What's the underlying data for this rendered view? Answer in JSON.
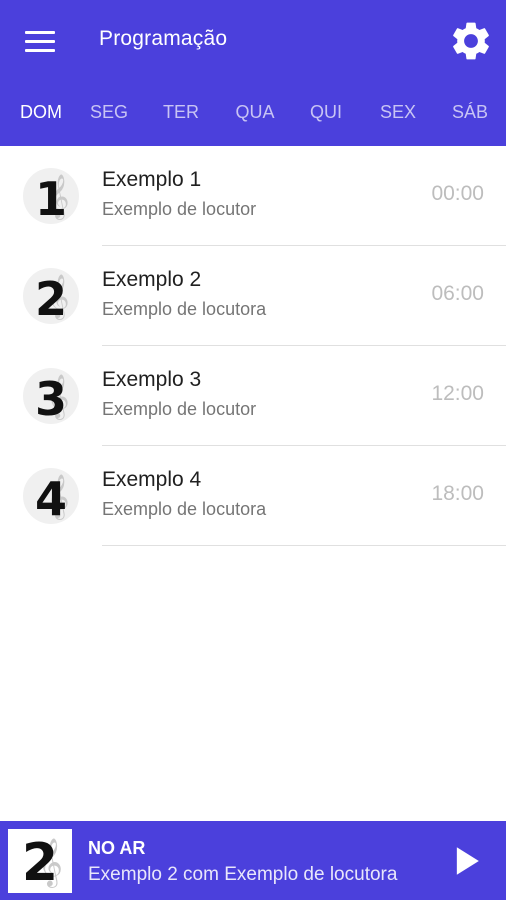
{
  "header": {
    "title": "Programação",
    "menu_icon": "hamburger-menu-icon",
    "settings_icon": "gear-icon",
    "color": "#4b40dc"
  },
  "tabs": [
    {
      "label": "DOM",
      "active": true
    },
    {
      "label": "SEG",
      "active": false
    },
    {
      "label": "TER",
      "active": false
    },
    {
      "label": "QUA",
      "active": false
    },
    {
      "label": "QUI",
      "active": false
    },
    {
      "label": "SEX",
      "active": false
    },
    {
      "label": "SÁB",
      "active": false
    }
  ],
  "schedule": [
    {
      "number": "1",
      "title": "Exemplo 1",
      "host": "Exemplo de locutor",
      "time": "00:00"
    },
    {
      "number": "2",
      "title": "Exemplo 2",
      "host": "Exemplo de locutora",
      "time": "06:00"
    },
    {
      "number": "3",
      "title": "Exemplo 3",
      "host": "Exemplo de locutor",
      "time": "12:00"
    },
    {
      "number": "4",
      "title": "Exemplo 4",
      "host": "Exemplo de locutora",
      "time": "18:00"
    }
  ],
  "player": {
    "cover_number": "2",
    "status": "NO AR",
    "now_playing": "Exemplo 2 com Exemplo de locutora",
    "play_icon": "play-icon"
  }
}
